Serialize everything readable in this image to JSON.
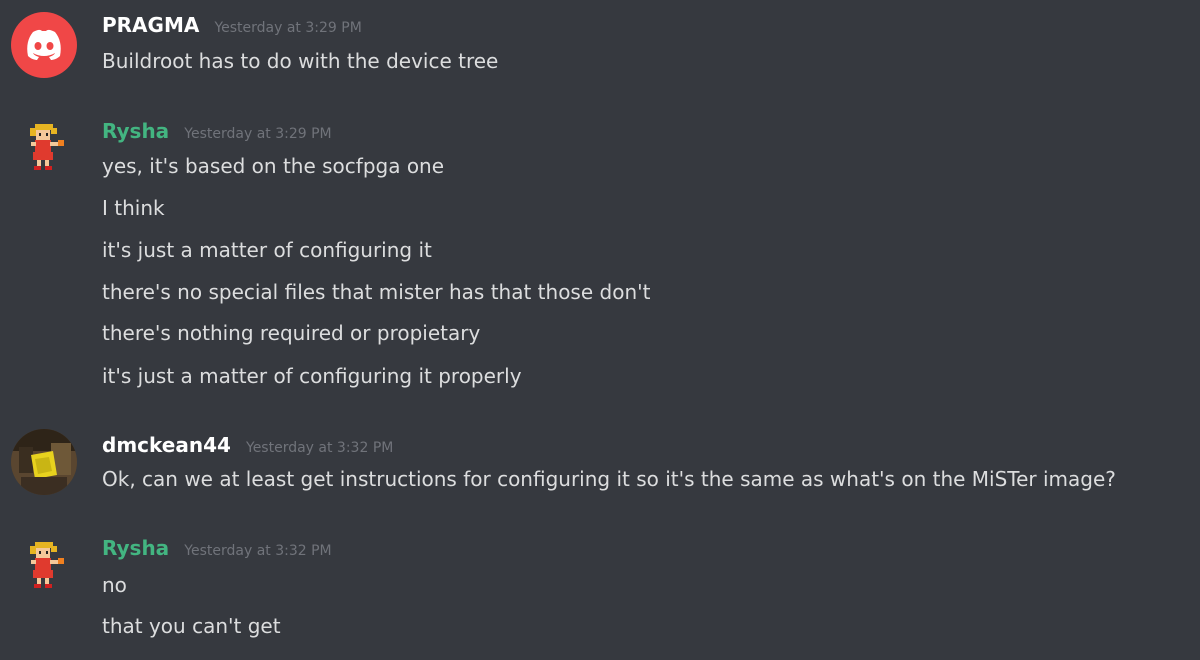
{
  "colors": {
    "background": "#36393f",
    "message_text": "#dcddde",
    "timestamp": "#70737a",
    "pragma_name": "#ffffff",
    "rysha_name": "#43b581",
    "dmckean_name": "#ffffff",
    "discord_red": "#f04747"
  },
  "groups": [
    {
      "author": "PRAGMA",
      "timestamp": "Yesterday at 3:29 PM",
      "avatar_icon": "discord-logo-icon",
      "lines": [
        "Buildroot has to do with the device tree"
      ]
    },
    {
      "author": "Rysha",
      "timestamp": "Yesterday at 3:29 PM",
      "avatar_icon": "pixel-girl-avatar",
      "lines": [
        "yes, it's based on the socfpga one",
        "I think",
        "it's just a matter of configuring it",
        "there's no special files that mister has that those don't",
        "there's nothing required or propietary",
        "it's just a matter of configuring it properly"
      ]
    },
    {
      "author": "dmckean44",
      "timestamp": "Yesterday at 3:32 PM",
      "avatar_icon": "photo-avatar",
      "lines": [
        "Ok, can we at least get instructions for configuring it so it's the same as what's on the MiSTer image?"
      ]
    },
    {
      "author": "Rysha",
      "timestamp": "Yesterday at 3:32 PM",
      "avatar_icon": "pixel-girl-avatar",
      "lines": [
        "no",
        "that you can't get"
      ]
    }
  ]
}
